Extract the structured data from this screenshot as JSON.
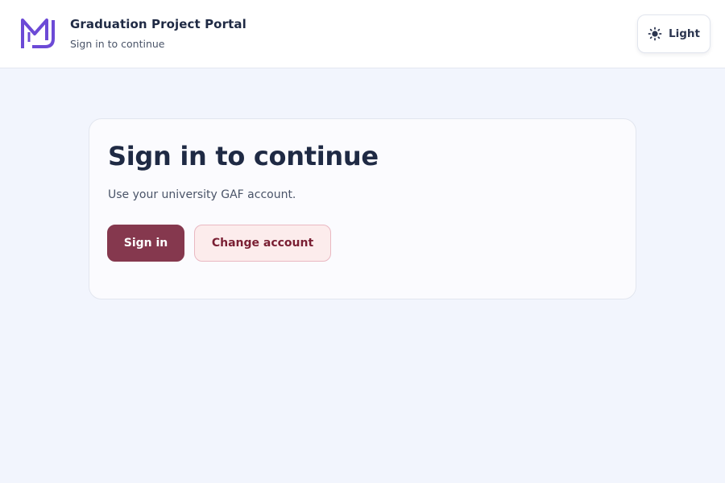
{
  "header": {
    "title": "Graduation Project Portal",
    "subtitle": "Sign in to continue",
    "logo_icon": "mj-logo-icon",
    "theme_toggle": {
      "label": "Light",
      "icon": "sun-icon"
    }
  },
  "card": {
    "title": "Sign in to continue",
    "description": "Use your university GAF account.",
    "primary_button": "Sign in",
    "secondary_button": "Change account"
  },
  "colors": {
    "page_background": "#f2f5fd",
    "logo_purple": "#6c4ad6",
    "primary_button": "#85384e",
    "secondary_button_bg": "#fcecec",
    "secondary_button_text": "#7a1f33",
    "text_dark": "#1f2a44"
  }
}
